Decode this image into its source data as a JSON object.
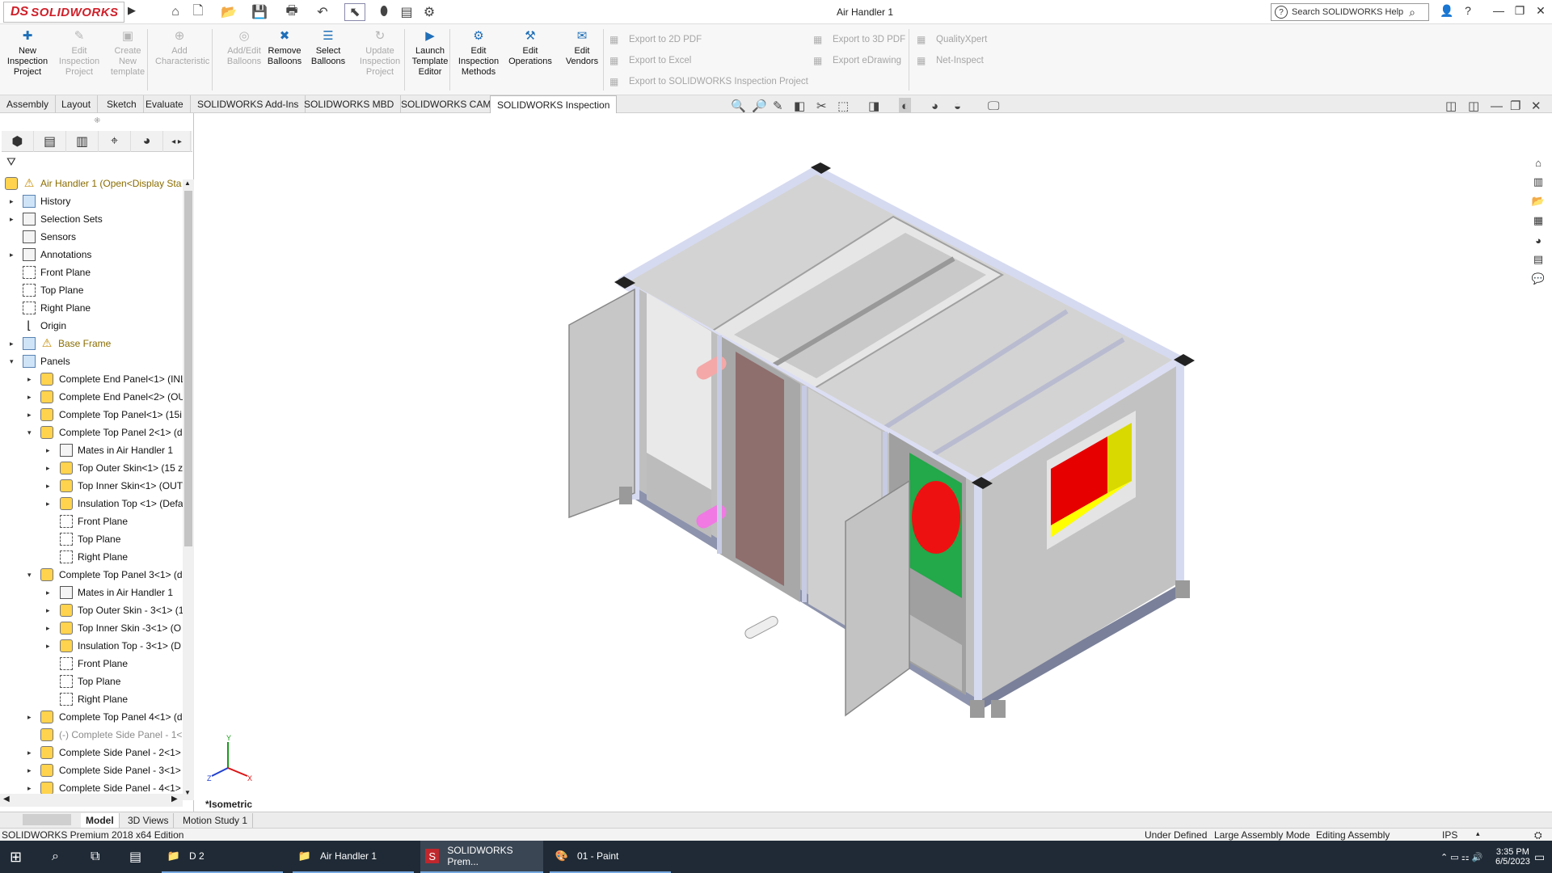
{
  "app": {
    "logo_ds": "DS",
    "logo_text": "SOLIDWORKS",
    "doc_title": "Air Handler 1",
    "search_placeholder": "Search SOLIDWORKS Help"
  },
  "ribbon": {
    "buttons": [
      {
        "label": "New\nInspection\nProject",
        "enabled": true
      },
      {
        "label": "Edit\nInspection\nProject",
        "enabled": false
      },
      {
        "label": "Create\nNew\ntemplate",
        "enabled": false
      },
      {
        "label": "Add\nCharacteristic",
        "enabled": false
      },
      {
        "label": "Add/Edit\nBalloons",
        "enabled": false
      },
      {
        "label": "Remove\nBalloons",
        "enabled": true
      },
      {
        "label": "Select\nBalloons",
        "enabled": true
      },
      {
        "label": "Update\nInspection\nProject",
        "enabled": false
      },
      {
        "label": "Launch\nTemplate\nEditor",
        "enabled": true
      },
      {
        "label": "Edit\nInspection\nMethods",
        "enabled": true
      },
      {
        "label": "Edit\nOperations",
        "enabled": true
      },
      {
        "label": "Edit\nVendors",
        "enabled": true
      }
    ],
    "exports": {
      "pdf2d": "Export to 2D PDF",
      "excel": "Export to Excel",
      "sw_inspection": "Export to SOLIDWORKS Inspection Project",
      "pdf3d": "Export to 3D PDF",
      "edrawing": "Export eDrawing",
      "qualityxpert": "QualityXpert",
      "netinspect": "Net-Inspect"
    }
  },
  "tabs": [
    "Assembly",
    "Layout",
    "Sketch",
    "Evaluate",
    "SOLIDWORKS Add-Ins",
    "SOLIDWORKS MBD",
    "SOLIDWORKS CAM",
    "SOLIDWORKS Inspection"
  ],
  "tree": {
    "root": "Air Handler 1  (Open<Display Sta",
    "items": [
      {
        "label": "History",
        "level": 1,
        "toggle": "▸",
        "icon": "folder"
      },
      {
        "label": "Selection Sets",
        "level": 1,
        "toggle": "▸",
        "icon": "box"
      },
      {
        "label": "Sensors",
        "level": 1,
        "toggle": "",
        "icon": "box"
      },
      {
        "label": "Annotations",
        "level": 1,
        "toggle": "▸",
        "icon": "box"
      },
      {
        "label": "Front Plane",
        "level": 1,
        "toggle": "",
        "icon": "plane"
      },
      {
        "label": "Top Plane",
        "level": 1,
        "toggle": "",
        "icon": "plane"
      },
      {
        "label": "Right Plane",
        "level": 1,
        "toggle": "",
        "icon": "plane"
      },
      {
        "label": "Origin",
        "level": 1,
        "toggle": "",
        "icon": "origin"
      },
      {
        "label": "Base Frame",
        "level": 1,
        "toggle": "▸",
        "icon": "folder",
        "warn": true,
        "style": "yellow"
      },
      {
        "label": "Panels",
        "level": 1,
        "toggle": "▾",
        "icon": "folder"
      },
      {
        "label": "Complete End Panel<1> (INL",
        "level": 2,
        "toggle": "▸",
        "icon": "part"
      },
      {
        "label": "Complete End Panel<2> (OU",
        "level": 2,
        "toggle": "▸",
        "icon": "part"
      },
      {
        "label": "Complete Top Panel<1> (15i",
        "level": 2,
        "toggle": "▸",
        "icon": "part"
      },
      {
        "label": "Complete Top Panel 2<1> (d",
        "level": 2,
        "toggle": "▾",
        "icon": "part"
      },
      {
        "label": "Mates in Air Handler 1",
        "level": 3,
        "toggle": "▸",
        "icon": "box"
      },
      {
        "label": "Top Outer Skin<1> (15 z",
        "level": 3,
        "toggle": "▸",
        "icon": "part"
      },
      {
        "label": "Top Inner Skin<1> (OUT",
        "level": 3,
        "toggle": "▸",
        "icon": "part"
      },
      {
        "label": "Insulation Top <1> (Defa",
        "level": 3,
        "toggle": "▸",
        "icon": "part"
      },
      {
        "label": "Front Plane",
        "level": 3,
        "toggle": "",
        "icon": "plane"
      },
      {
        "label": "Top Plane",
        "level": 3,
        "toggle": "",
        "icon": "plane"
      },
      {
        "label": "Right Plane",
        "level": 3,
        "toggle": "",
        "icon": "plane"
      },
      {
        "label": "Complete Top Panel 3<1> (d",
        "level": 2,
        "toggle": "▾",
        "icon": "part"
      },
      {
        "label": "Mates in Air Handler 1",
        "level": 3,
        "toggle": "▸",
        "icon": "box"
      },
      {
        "label": "Top Outer Skin - 3<1> (1",
        "level": 3,
        "toggle": "▸",
        "icon": "part"
      },
      {
        "label": "Top Inner Skin -3<1> (O",
        "level": 3,
        "toggle": "▸",
        "icon": "part"
      },
      {
        "label": "Insulation Top  - 3<1> (D",
        "level": 3,
        "toggle": "▸",
        "icon": "part"
      },
      {
        "label": "Front Plane",
        "level": 3,
        "toggle": "",
        "icon": "plane"
      },
      {
        "label": "Top Plane",
        "level": 3,
        "toggle": "",
        "icon": "plane"
      },
      {
        "label": "Right Plane",
        "level": 3,
        "toggle": "",
        "icon": "plane"
      },
      {
        "label": "Complete Top Panel 4<1> (d",
        "level": 2,
        "toggle": "▸",
        "icon": "part"
      },
      {
        "label": "(-) Complete Side Panel - 1<",
        "level": 2,
        "toggle": "",
        "icon": "part",
        "style": "grey"
      },
      {
        "label": "Complete Side Panel - 2<1>",
        "level": 2,
        "toggle": "▸",
        "icon": "part"
      },
      {
        "label": "Complete Side Panel - 3<1>",
        "level": 2,
        "toggle": "▸",
        "icon": "part"
      },
      {
        "label": "Complete Side Panel - 4<1>",
        "level": 2,
        "toggle": "▸",
        "icon": "part"
      }
    ]
  },
  "view": {
    "orientation": "*Isometric",
    "triad": {
      "x": "X",
      "y": "Y",
      "z": "Z"
    }
  },
  "model_tabs": [
    "Model",
    "3D Views",
    "Motion Study 1"
  ],
  "status": {
    "edition": "SOLIDWORKS Premium 2018 x64 Edition",
    "defined": "Under Defined",
    "mode": "Large Assembly Mode",
    "editing": "Editing Assembly",
    "units": "IPS"
  },
  "taskbar": {
    "apps": [
      {
        "label": "D 2"
      },
      {
        "label": "Air Handler 1"
      },
      {
        "label": "SOLIDWORKS Prem..."
      },
      {
        "label": "01 - Paint"
      }
    ],
    "time": "3:35 PM",
    "date": "6/5/2023"
  },
  "colors": {
    "brand_red": "#d0202a",
    "taskbar": "#1f2a36",
    "frame": "#d8dcf2",
    "panel": "#c9c9c9"
  }
}
